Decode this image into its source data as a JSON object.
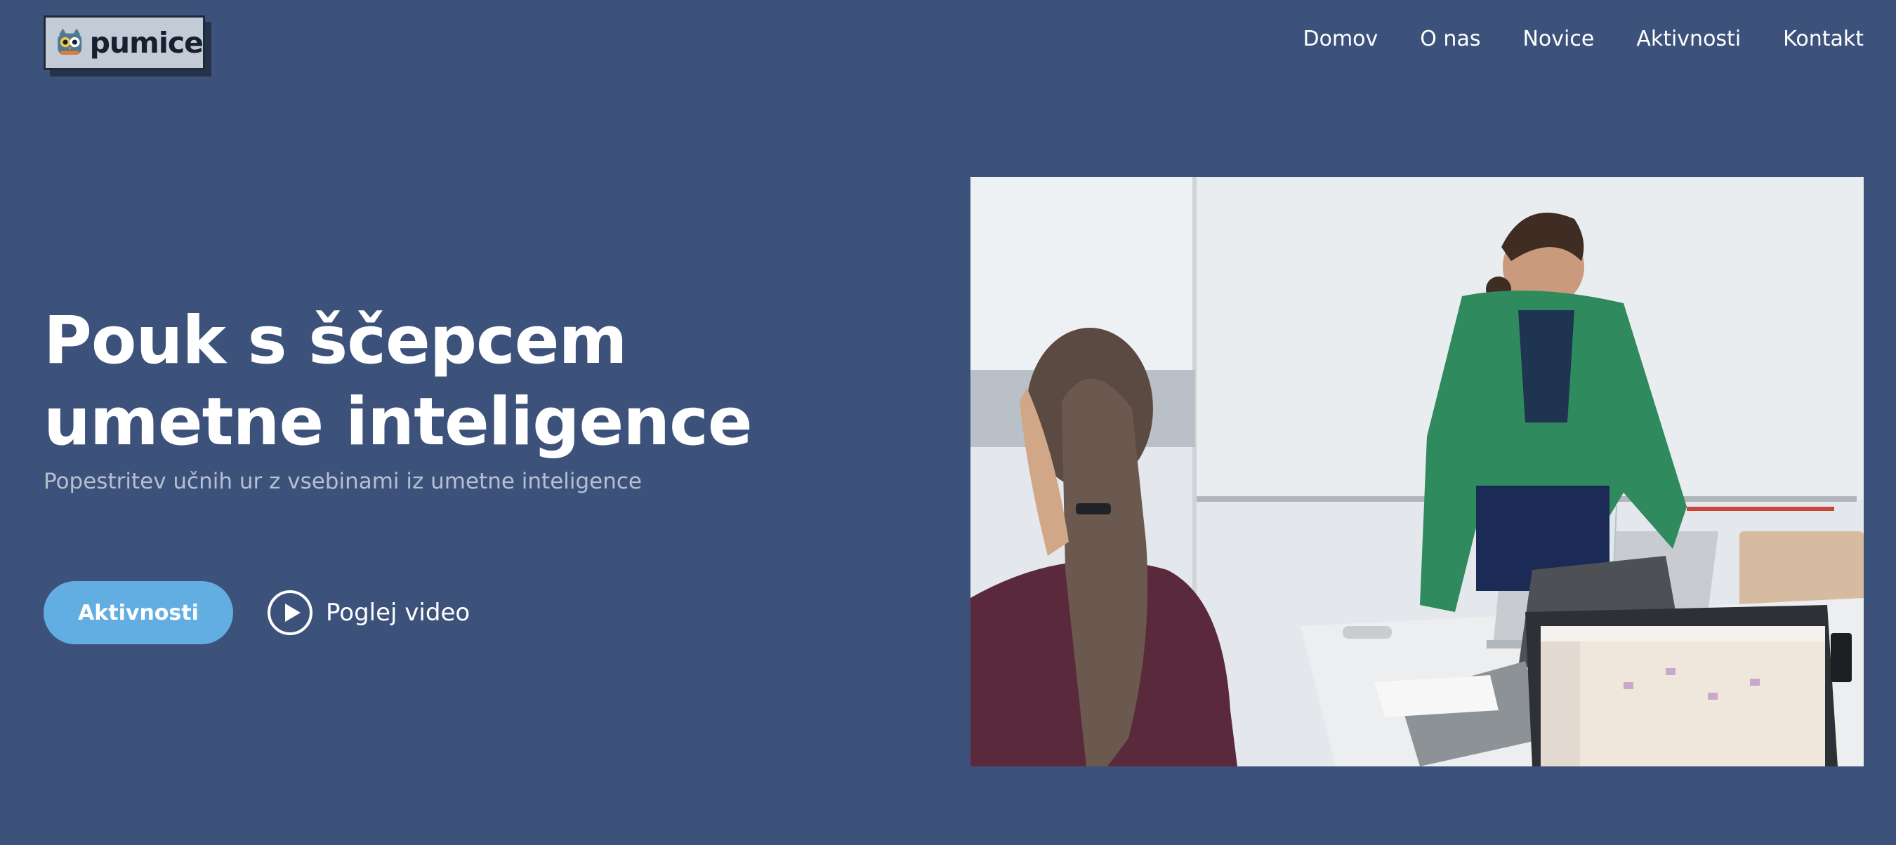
{
  "header": {
    "logo_text": "pumice",
    "nav": [
      {
        "label": "Domov"
      },
      {
        "label": "O nas"
      },
      {
        "label": "Novice"
      },
      {
        "label": "Aktivnosti"
      },
      {
        "label": "Kontakt"
      }
    ]
  },
  "hero": {
    "title": "Pouk s ščepcem umetne inteligence",
    "subtitle": "Popestritev učnih ur z vsebinami iz umetne inteligence",
    "primary_button": "Aktivnosti",
    "video_link": "Poglej video",
    "image_icon": "classroom-photo"
  },
  "colors": {
    "background": "#3d527b",
    "accent": "#62aee2",
    "subtitle": "#b5bfd0"
  }
}
